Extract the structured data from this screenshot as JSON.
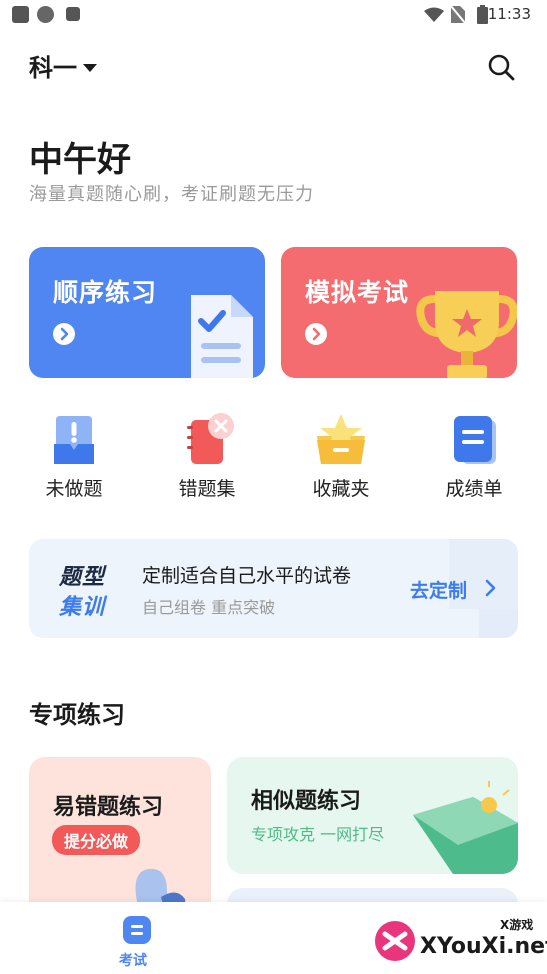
{
  "status_bar": {
    "time": "11:33"
  },
  "header": {
    "subject": "科一"
  },
  "greeting": {
    "title": "中午好",
    "subtitle": "海量真题随心刷，考证刷题无压力"
  },
  "main_cards": [
    {
      "label": "顺序练习",
      "color": "#4f86f2"
    },
    {
      "label": "模拟考试",
      "color": "#f46c6f"
    }
  ],
  "quick_actions": [
    {
      "label": "未做题",
      "icon": "unanswered-icon"
    },
    {
      "label": "错题集",
      "icon": "wrong-book-icon"
    },
    {
      "label": "收藏夹",
      "icon": "favorites-icon"
    },
    {
      "label": "成绩单",
      "icon": "scorecard-icon"
    }
  ],
  "training_banner": {
    "logo_line1": "题型",
    "logo_line2": "集训",
    "title": "定制适合自己水平的试卷",
    "subtitle": "自己组卷 重点突破",
    "action": "去定制"
  },
  "special_practice": {
    "title": "专项练习",
    "cards": [
      {
        "title": "易错题练习",
        "badge": "提分必做"
      },
      {
        "title": "相似题练习",
        "subtitle": "专项攻克 一网打尽"
      }
    ]
  },
  "bottom_nav": {
    "items": [
      {
        "label": "考试",
        "active": true
      }
    ]
  },
  "watermark": {
    "text": "XYouXi.net",
    "small": "X游戏"
  },
  "colors": {
    "accent": "#4f86f2",
    "danger": "#f46c6f",
    "green": "#4fbb88"
  }
}
